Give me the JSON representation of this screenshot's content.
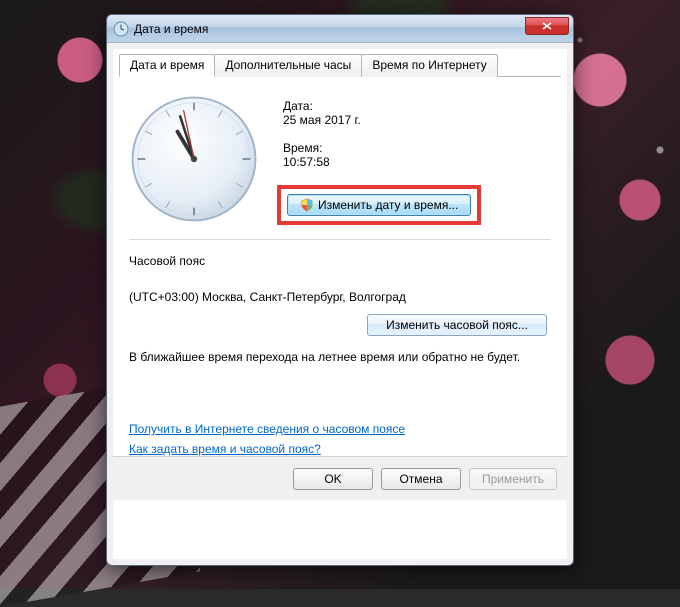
{
  "window": {
    "title": "Дата и время"
  },
  "tabs": [
    {
      "label": "Дата и время",
      "active": true
    },
    {
      "label": "Дополнительные часы",
      "active": false
    },
    {
      "label": "Время по Интернету",
      "active": false
    }
  ],
  "date": {
    "label": "Дата:",
    "value": "25 мая 2017 г."
  },
  "time": {
    "label": "Время:",
    "value": "10:57:58",
    "hour": 10,
    "minute": 57,
    "second": 58
  },
  "buttons": {
    "change_datetime": "Изменить дату и время...",
    "change_timezone": "Изменить часовой пояс...",
    "ok": "OK",
    "cancel": "Отмена",
    "apply": "Применить"
  },
  "timezone": {
    "heading": "Часовой пояс",
    "value": "(UTC+03:00) Москва, Санкт-Петербург, Волгоград"
  },
  "dst_notice": "В ближайшее время перехода на летнее время или обратно не будет.",
  "links": {
    "online_info": "Получить в Интернете сведения о часовом поясе",
    "howto": "Как задать время и часовой пояс?"
  }
}
